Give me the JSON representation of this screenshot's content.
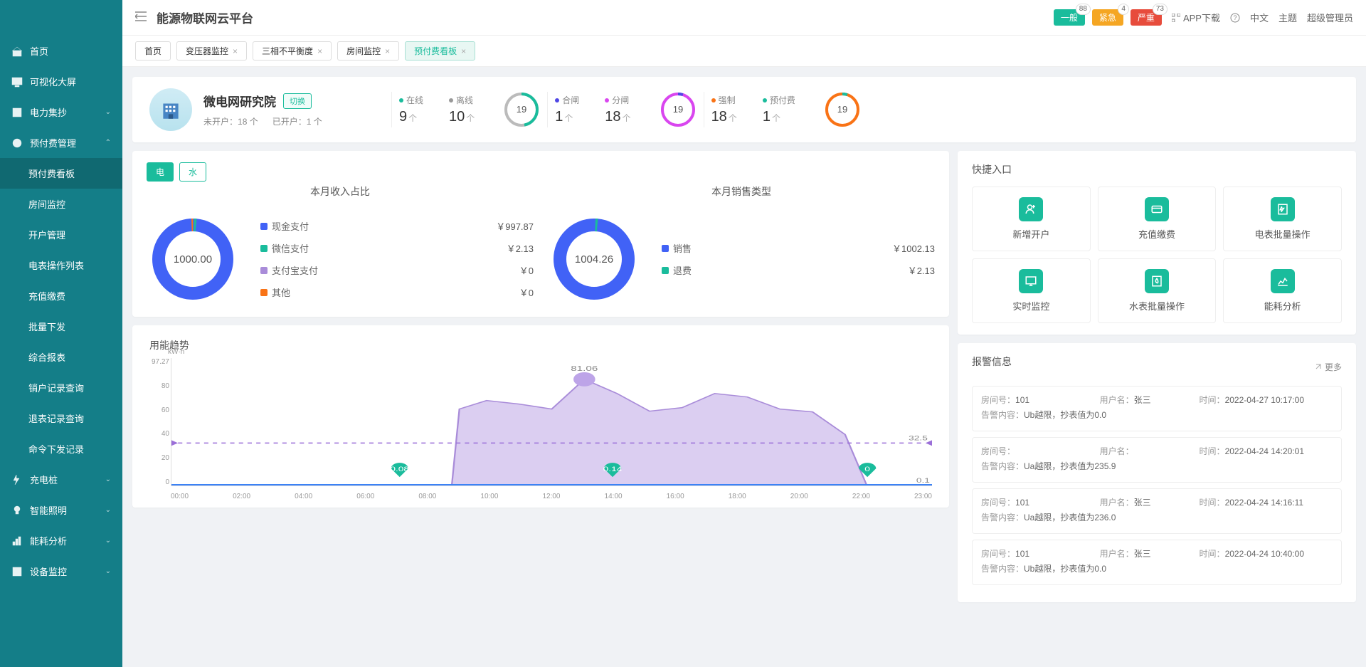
{
  "app_title": "能源物联网云平台",
  "top": {
    "alerts": [
      {
        "label": "一般",
        "count": "88",
        "cls": "g"
      },
      {
        "label": "紧急",
        "count": "4",
        "cls": "o"
      },
      {
        "label": "严重",
        "count": "73",
        "cls": "r"
      }
    ],
    "app_download": "APP下载",
    "lang": "中文",
    "theme": "主题",
    "user": "超级管理员"
  },
  "sidebar": [
    {
      "label": "首页",
      "icon": "home"
    },
    {
      "label": "可视化大屏",
      "icon": "screen"
    },
    {
      "label": "电力集抄",
      "icon": "meter",
      "chev": "down"
    },
    {
      "label": "预付费管理",
      "icon": "prepay",
      "chev": "up",
      "expanded": true,
      "children": [
        {
          "label": "预付费看板",
          "active": true
        },
        {
          "label": "房间监控"
        },
        {
          "label": "开户管理"
        },
        {
          "label": "电表操作列表"
        },
        {
          "label": "充值缴费"
        },
        {
          "label": "批量下发"
        },
        {
          "label": "综合报表"
        },
        {
          "label": "销户记录查询"
        },
        {
          "label": "退表记录查询"
        },
        {
          "label": "命令下发记录"
        }
      ]
    },
    {
      "label": "充电桩",
      "icon": "charge",
      "chev": "down"
    },
    {
      "label": "智能照明",
      "icon": "light",
      "chev": "down"
    },
    {
      "label": "能耗分析",
      "icon": "energy",
      "chev": "down"
    },
    {
      "label": "设备监控",
      "icon": "device",
      "chev": "down"
    }
  ],
  "tabs": [
    {
      "label": "首页"
    },
    {
      "label": "变压器监控",
      "closable": true
    },
    {
      "label": "三相不平衡度",
      "closable": true
    },
    {
      "label": "房间监控",
      "closable": true
    },
    {
      "label": "预付费看板",
      "closable": true,
      "active": true
    }
  ],
  "org": {
    "name": "微电网研究院",
    "switch": "切换",
    "not_opened_label": "未开户：",
    "not_opened_value": "18",
    "opened_label": "已开户：",
    "opened_value": "1",
    "unit": "个"
  },
  "stats": {
    "online": {
      "label": "在线",
      "value": "9",
      "unit": "个",
      "color": "#1abc9c"
    },
    "offline": {
      "label": "离线",
      "value": "10",
      "unit": "个",
      "color": "#999"
    },
    "ring1": "19",
    "close_gate": {
      "label": "合闸",
      "value": "1",
      "unit": "个",
      "color": "#4f46e5"
    },
    "open_gate": {
      "label": "分闸",
      "value": "18",
      "unit": "个",
      "color": "#d946ef"
    },
    "ring2": "19",
    "force": {
      "label": "强制",
      "value": "18",
      "unit": "个",
      "color": "#f97316"
    },
    "prepay": {
      "label": "预付费",
      "value": "1",
      "unit": "个",
      "color": "#1abc9c"
    },
    "ring3": "19"
  },
  "toggle": {
    "elec": "电",
    "water": "水"
  },
  "pie1": {
    "title": "本月收入占比",
    "center": "1000.00",
    "items": [
      {
        "name": "现金支付",
        "value": "￥997.87",
        "color": "#4162f6"
      },
      {
        "name": "微信支付",
        "value": "￥2.13",
        "color": "#1abc9c"
      },
      {
        "name": "支付宝支付",
        "value": "￥0",
        "color": "#a98cd9"
      },
      {
        "name": "其他",
        "value": "￥0",
        "color": "#f97316"
      }
    ]
  },
  "pie2": {
    "title": "本月销售类型",
    "center": "1004.26",
    "items": [
      {
        "name": "销售",
        "value": "￥1002.13",
        "color": "#4162f6"
      },
      {
        "name": "退费",
        "value": "￥2.13",
        "color": "#1abc9c"
      }
    ]
  },
  "trend": {
    "title": "用能趋势",
    "unit": "kW·h",
    "peak_label": "81.06",
    "baseline_label": "32.5",
    "last_label": "0.1",
    "markers": [
      {
        "x": 0.3,
        "label": "0.08"
      },
      {
        "x": 0.58,
        "label": "0.14"
      },
      {
        "x": 0.915,
        "label": "0"
      }
    ]
  },
  "chart_data": {
    "type": "area",
    "title": "用能趋势",
    "xlabel": "",
    "ylabel": "kW·h",
    "ylim": [
      0,
      97.27
    ],
    "y_ticks": [
      0,
      20,
      40,
      60,
      80,
      97.27
    ],
    "x_ticks": [
      "00:00",
      "02:00",
      "04:00",
      "06:00",
      "08:00",
      "10:00",
      "12:00",
      "14:00",
      "16:00",
      "18:00",
      "20:00",
      "22:00",
      "23:00"
    ],
    "baseline": 32.5,
    "peak": {
      "x": "13:00",
      "y": 81.06
    },
    "values": [
      {
        "x": "00:00",
        "y": 0
      },
      {
        "x": "02:00",
        "y": 0
      },
      {
        "x": "04:00",
        "y": 0
      },
      {
        "x": "06:00",
        "y": 0
      },
      {
        "x": "07:00",
        "y": 0.08
      },
      {
        "x": "08:00",
        "y": 0
      },
      {
        "x": "09:00",
        "y": 62
      },
      {
        "x": "10:00",
        "y": 66
      },
      {
        "x": "11:00",
        "y": 64
      },
      {
        "x": "12:00",
        "y": 60
      },
      {
        "x": "13:00",
        "y": 81.06
      },
      {
        "x": "14:00",
        "y": 73
      },
      {
        "x": "15:00",
        "y": 59
      },
      {
        "x": "16:00",
        "y": 60
      },
      {
        "x": "17:00",
        "y": 73
      },
      {
        "x": "18:00",
        "y": 70
      },
      {
        "x": "19:00",
        "y": 60
      },
      {
        "x": "20:00",
        "y": 56
      },
      {
        "x": "21:00",
        "y": 40
      },
      {
        "x": "22:00",
        "y": 0
      },
      {
        "x": "23:00",
        "y": 0.1
      }
    ]
  },
  "quick": {
    "title": "快捷入口",
    "items": [
      {
        "label": "新增开户",
        "icon": "user-plus"
      },
      {
        "label": "充值缴费",
        "icon": "pay"
      },
      {
        "label": "电表批量操作",
        "icon": "batch-elec"
      },
      {
        "label": "实时监控",
        "icon": "monitor"
      },
      {
        "label": "水表批量操作",
        "icon": "batch-water"
      },
      {
        "label": "能耗分析",
        "icon": "analysis"
      }
    ]
  },
  "alarm": {
    "title": "报警信息",
    "more": "更多",
    "room_label": "房间号：",
    "user_label": "用户名：",
    "time_label": "时间：",
    "content_label": "告警内容：",
    "items": [
      {
        "room": "101",
        "user": "张三",
        "time": "2022-04-27 10:17:00",
        "content": "Ub越限，抄表值为0.0"
      },
      {
        "room": "",
        "user": "",
        "time": "2022-04-24 14:20:01",
        "content": "Ua越限，抄表值为235.9"
      },
      {
        "room": "101",
        "user": "张三",
        "time": "2022-04-24 14:16:11",
        "content": "Ua越限，抄表值为236.0"
      },
      {
        "room": "101",
        "user": "张三",
        "time": "2022-04-24 10:40:00",
        "content": "Ub越限，抄表值为0.0"
      }
    ]
  }
}
